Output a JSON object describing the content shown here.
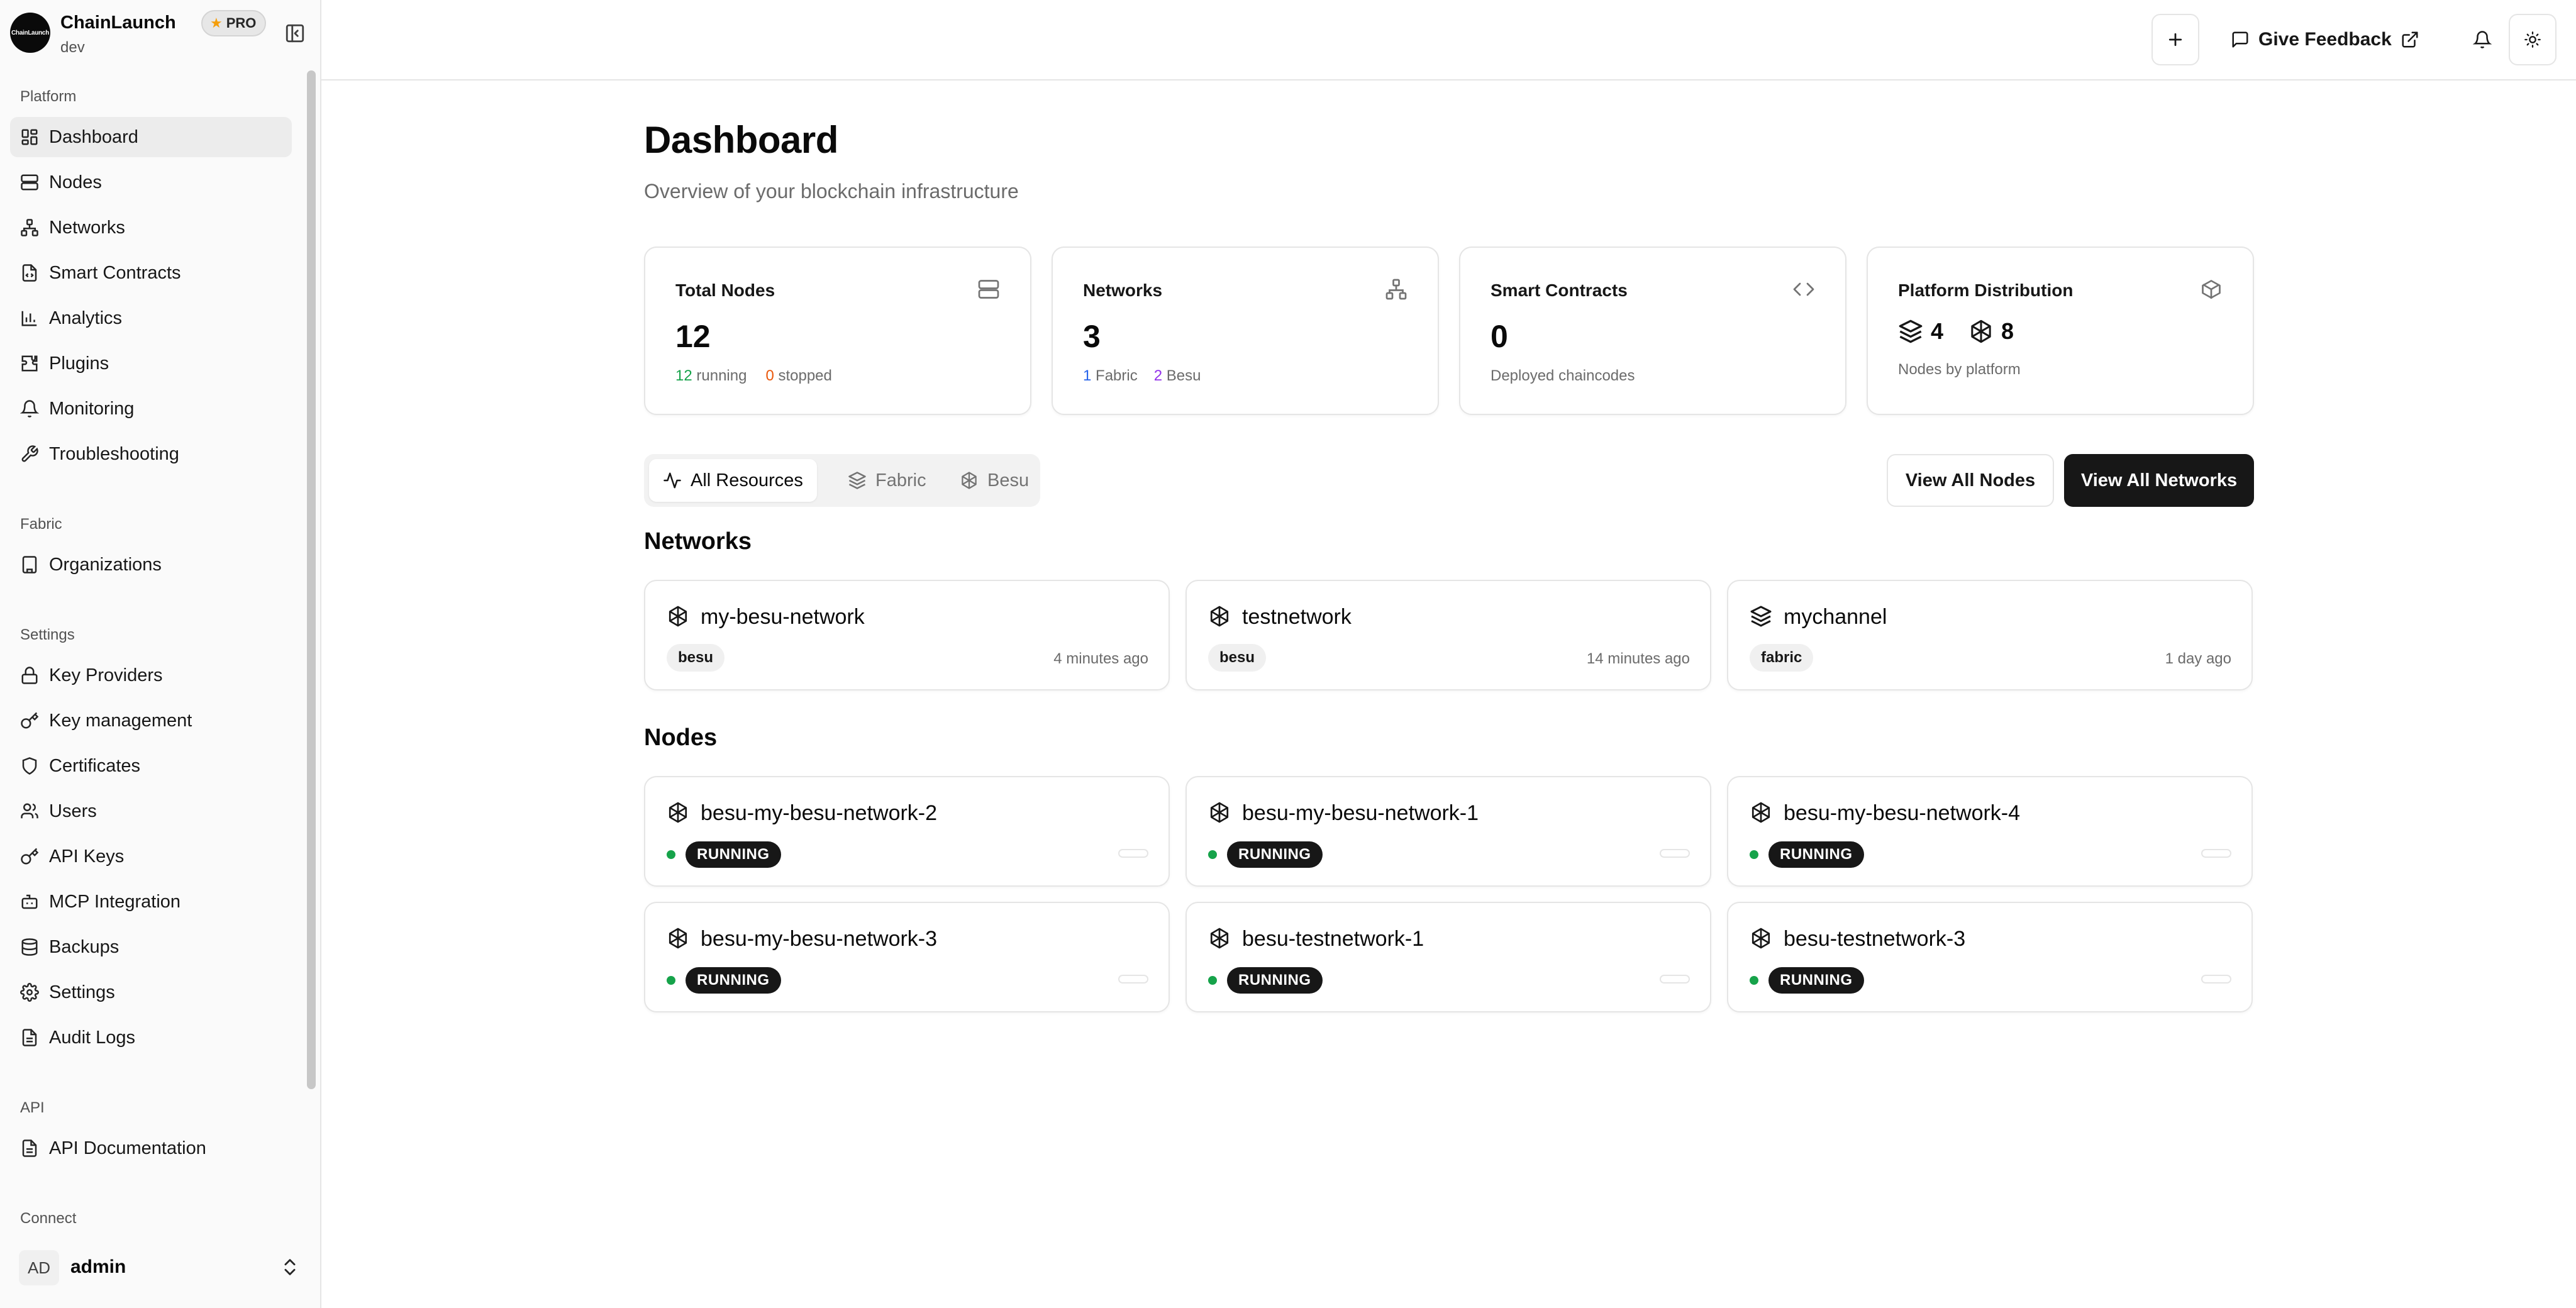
{
  "sidebar": {
    "brand_logo": "ChainLaunch",
    "brand_name": "ChainLaunch",
    "env": "dev",
    "pro_badge": "PRO",
    "groups": {
      "platform": "Platform",
      "fabric": "Fabric",
      "settings": "Settings",
      "api": "API",
      "connect": "Connect"
    },
    "platform_items": [
      {
        "label": "Dashboard",
        "icon": "layout-grid-icon"
      },
      {
        "label": "Nodes",
        "icon": "server-icon"
      },
      {
        "label": "Networks",
        "icon": "network-icon"
      },
      {
        "label": "Smart Contracts",
        "icon": "file-code-icon"
      },
      {
        "label": "Analytics",
        "icon": "bar-chart-icon"
      },
      {
        "label": "Plugins",
        "icon": "puzzle-icon"
      },
      {
        "label": "Monitoring",
        "icon": "bell-icon"
      },
      {
        "label": "Troubleshooting",
        "icon": "wrench-icon"
      }
    ],
    "fabric_items": [
      {
        "label": "Organizations",
        "icon": "building-icon"
      }
    ],
    "settings_items": [
      {
        "label": "Key Providers",
        "icon": "lock-icon"
      },
      {
        "label": "Key management",
        "icon": "key-icon"
      },
      {
        "label": "Certificates",
        "icon": "shield-icon"
      },
      {
        "label": "Users",
        "icon": "users-icon"
      },
      {
        "label": "API Keys",
        "icon": "key-icon"
      },
      {
        "label": "MCP Integration",
        "icon": "bot-icon"
      },
      {
        "label": "Backups",
        "icon": "database-icon"
      },
      {
        "label": "Settings",
        "icon": "gear-icon"
      },
      {
        "label": "Audit Logs",
        "icon": "file-text-icon"
      }
    ],
    "api_items": [
      {
        "label": "API Documentation",
        "icon": "file-text-icon"
      }
    ],
    "user": {
      "initials": "AD",
      "name": "admin"
    }
  },
  "topbar": {
    "feedback_label": "Give Feedback"
  },
  "page": {
    "title": "Dashboard",
    "subtitle": "Overview of your blockchain infrastructure"
  },
  "stats": {
    "nodes": {
      "title": "Total Nodes",
      "value": "12",
      "running": "12",
      "running_label": "running",
      "stopped": "0",
      "stopped_label": "stopped"
    },
    "networks": {
      "title": "Networks",
      "value": "3",
      "fabric": "1",
      "fabric_label": "Fabric",
      "besu": "2",
      "besu_label": "Besu"
    },
    "contracts": {
      "title": "Smart Contracts",
      "value": "0",
      "sub": "Deployed chaincodes"
    },
    "distribution": {
      "title": "Platform Distribution",
      "fabric_count": "4",
      "besu_count": "8",
      "sub": "Nodes by platform"
    }
  },
  "filters": {
    "all": "All Resources",
    "fabric": "Fabric",
    "besu": "Besu"
  },
  "actions": {
    "view_nodes": "View All Nodes",
    "view_networks": "View All Networks"
  },
  "networks_section": {
    "title": "Networks",
    "items": [
      {
        "name": "my-besu-network",
        "tag": "besu",
        "time": "4 minutes ago",
        "platform": "besu"
      },
      {
        "name": "testnetwork",
        "tag": "besu",
        "time": "14 minutes ago",
        "platform": "besu"
      },
      {
        "name": "mychannel",
        "tag": "fabric",
        "time": "1 day ago",
        "platform": "fabric"
      }
    ]
  },
  "nodes_section": {
    "title": "Nodes",
    "items": [
      {
        "name": "besu-my-besu-network-2",
        "status": "RUNNING"
      },
      {
        "name": "besu-my-besu-network-1",
        "status": "RUNNING"
      },
      {
        "name": "besu-my-besu-network-4",
        "status": "RUNNING"
      },
      {
        "name": "besu-my-besu-network-3",
        "status": "RUNNING"
      },
      {
        "name": "besu-testnetwork-1",
        "status": "RUNNING"
      },
      {
        "name": "besu-testnetwork-3",
        "status": "RUNNING"
      }
    ]
  },
  "colors": {
    "running": "#16a34a",
    "stopped": "#ea580c",
    "fabric": "#2563eb",
    "besu": "#9333ea",
    "primary_button": "#171717"
  }
}
